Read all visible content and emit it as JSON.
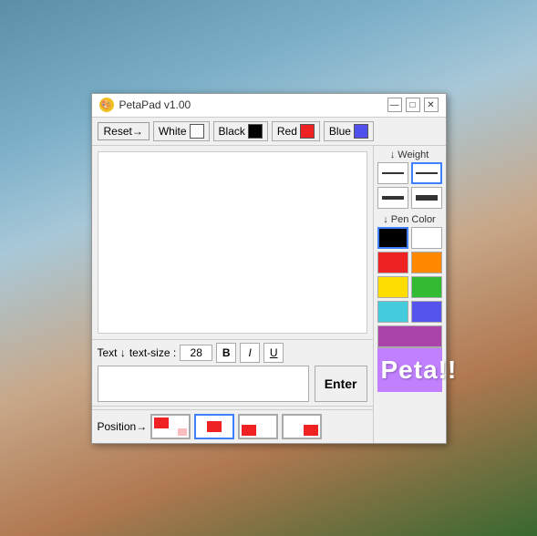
{
  "window": {
    "title": "PetaPad v1.00",
    "icon": "🎨",
    "min_button": "—",
    "max_button": "□",
    "close_button": "✕"
  },
  "toolbar": {
    "reset_label": "Reset→",
    "white_label": "White",
    "black_label": "Black",
    "red_label": "Red",
    "blue_label": "Blue",
    "white_color": "#ffffff",
    "black_color": "#000000",
    "red_color": "#ee2222",
    "blue_color": "#5050ee"
  },
  "side_panel": {
    "weight_label": "↓ Weight",
    "pen_color_label": "↓ Pen Color",
    "weights": [
      {
        "id": "w1",
        "height": 2,
        "selected": false
      },
      {
        "id": "w2",
        "height": 2,
        "selected": true
      },
      {
        "id": "w3",
        "height": 4,
        "selected": false
      },
      {
        "id": "w4",
        "height": 5,
        "selected": false
      }
    ],
    "pen_colors": [
      {
        "id": "pc1",
        "color": "#000000",
        "selected": true
      },
      {
        "id": "pc2",
        "color": "#ffffff",
        "selected": false
      },
      {
        "id": "pc3",
        "color": "#ee2222",
        "selected": false
      },
      {
        "id": "pc4",
        "color": "#ff8800",
        "selected": false
      },
      {
        "id": "pc5",
        "color": "#ffdd00",
        "selected": false
      },
      {
        "id": "pc6",
        "color": "#33bb33",
        "selected": false
      },
      {
        "id": "pc7",
        "color": "#44ccdd",
        "selected": false
      },
      {
        "id": "pc8",
        "color": "#5555ee",
        "selected": false
      },
      {
        "id": "pc9",
        "color": "#aa44aa",
        "selected": false
      }
    ],
    "peta_label": "Peta!!"
  },
  "text_toolbar": {
    "text_label": "Text ↓",
    "text_size_label": "text-size :",
    "text_size_value": "28",
    "bold_label": "B",
    "italic_label": "I",
    "underline_label": "U",
    "enter_label": "Enter"
  },
  "position": {
    "label": "Position→"
  }
}
